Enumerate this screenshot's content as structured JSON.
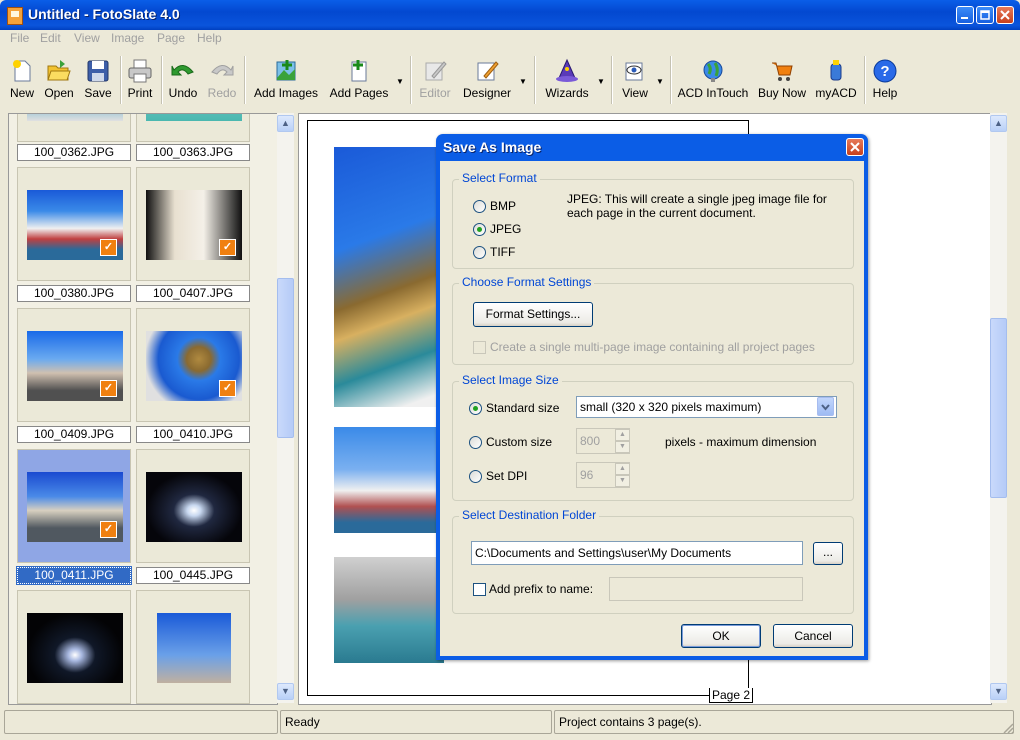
{
  "window": {
    "title": "Untitled - FotoSlate 4.0"
  },
  "menu": [
    "File",
    "Edit",
    "View",
    "Image",
    "Page",
    "Help"
  ],
  "toolbar": {
    "new": "New",
    "open": "Open",
    "save": "Save",
    "print": "Print",
    "undo": "Undo",
    "redo": "Redo",
    "add_images": "Add Images",
    "add_pages": "Add Pages",
    "editor": "Editor",
    "designer": "Designer",
    "wizards": "Wizards",
    "view": "View",
    "acd_intouch": "ACD InTouch",
    "buy_now": "Buy Now",
    "myacd": "myACD",
    "help": "Help"
  },
  "thumbnails": [
    {
      "name": "100_0362.JPG",
      "checked": false
    },
    {
      "name": "100_0363.JPG",
      "checked": false
    },
    {
      "name": "100_0380.JPG",
      "checked": true
    },
    {
      "name": "100_0407.JPG",
      "checked": true
    },
    {
      "name": "100_0409.JPG",
      "checked": true
    },
    {
      "name": "100_0410.JPG",
      "checked": true
    },
    {
      "name": "100_0411.JPG",
      "checked": true,
      "selected": true
    },
    {
      "name": "100_0445.JPG",
      "checked": false
    },
    {
      "name": "",
      "checked": false
    },
    {
      "name": "",
      "checked": false
    }
  ],
  "page": {
    "label": "Page 2"
  },
  "status": {
    "ready": "Ready",
    "project_info": "Project contains 3 page(s)."
  },
  "dialog": {
    "title": "Save As Image",
    "select_format": {
      "title": "Select Format",
      "options": [
        "BMP",
        "JPEG",
        "TIFF"
      ],
      "selected": "JPEG",
      "description": "JPEG: This will create a single jpeg image file for each page in the current document."
    },
    "format_settings": {
      "title": "Choose Format Settings",
      "button": "Format Settings...",
      "multipage_label": "Create a single multi-page image containing all project pages"
    },
    "image_size": {
      "title": "Select Image Size",
      "standard_label": "Standard size",
      "standard_value": "small (320 x 320 pixels maximum)",
      "custom_label": "Custom size",
      "custom_value": "800",
      "custom_unit": "pixels - maximum dimension",
      "dpi_label": "Set DPI",
      "dpi_value": "96",
      "selected": "Standard size"
    },
    "destination": {
      "title": "Select Destination Folder",
      "path": "C:\\Documents and Settings\\user\\My Documents",
      "browse_label": "...",
      "prefix_label": "Add prefix to name:",
      "prefix_value": ""
    },
    "ok_label": "OK",
    "cancel_label": "Cancel"
  },
  "colors": {
    "titlebar": "#0348d0",
    "selection": "#316ac5",
    "group_title": "#0046d5"
  }
}
